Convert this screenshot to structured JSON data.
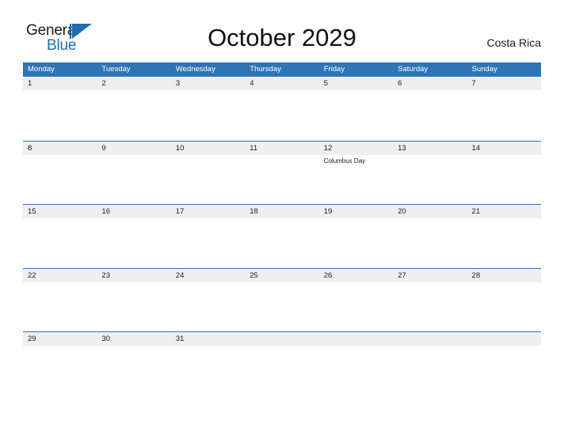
{
  "header": {
    "logo": {
      "line1": "General",
      "line2": "Blue",
      "triangle_icon": "blue-triangle-icon"
    },
    "title": "October 2029",
    "locale": "Costa Rica"
  },
  "colors": {
    "header_blue": "#2e75b6",
    "row_separator_blue": "#2e75b6",
    "daynum_strip_gray": "#efefef",
    "logo_blue": "#1f6cb0",
    "text_dark": "#1a1a1a",
    "white": "#ffffff"
  },
  "calendar": {
    "weekdays": [
      "Monday",
      "Tuesday",
      "Wednesday",
      "Thursday",
      "Friday",
      "Saturday",
      "Sunday"
    ],
    "weeks": [
      {
        "days": [
          {
            "num": "1",
            "events": []
          },
          {
            "num": "2",
            "events": []
          },
          {
            "num": "3",
            "events": []
          },
          {
            "num": "4",
            "events": []
          },
          {
            "num": "5",
            "events": []
          },
          {
            "num": "6",
            "events": []
          },
          {
            "num": "7",
            "events": []
          }
        ]
      },
      {
        "days": [
          {
            "num": "8",
            "events": []
          },
          {
            "num": "9",
            "events": []
          },
          {
            "num": "10",
            "events": []
          },
          {
            "num": "11",
            "events": []
          },
          {
            "num": "12",
            "events": [
              "Columbus Day"
            ]
          },
          {
            "num": "13",
            "events": []
          },
          {
            "num": "14",
            "events": []
          }
        ]
      },
      {
        "days": [
          {
            "num": "15",
            "events": []
          },
          {
            "num": "16",
            "events": []
          },
          {
            "num": "17",
            "events": []
          },
          {
            "num": "18",
            "events": []
          },
          {
            "num": "19",
            "events": []
          },
          {
            "num": "20",
            "events": []
          },
          {
            "num": "21",
            "events": []
          }
        ]
      },
      {
        "days": [
          {
            "num": "22",
            "events": []
          },
          {
            "num": "23",
            "events": []
          },
          {
            "num": "24",
            "events": []
          },
          {
            "num": "25",
            "events": []
          },
          {
            "num": "26",
            "events": []
          },
          {
            "num": "27",
            "events": []
          },
          {
            "num": "28",
            "events": []
          }
        ]
      },
      {
        "days": [
          {
            "num": "29",
            "events": []
          },
          {
            "num": "30",
            "events": []
          },
          {
            "num": "31",
            "events": []
          },
          {
            "num": "",
            "events": []
          },
          {
            "num": "",
            "events": []
          },
          {
            "num": "",
            "events": []
          },
          {
            "num": "",
            "events": []
          }
        ]
      }
    ]
  }
}
